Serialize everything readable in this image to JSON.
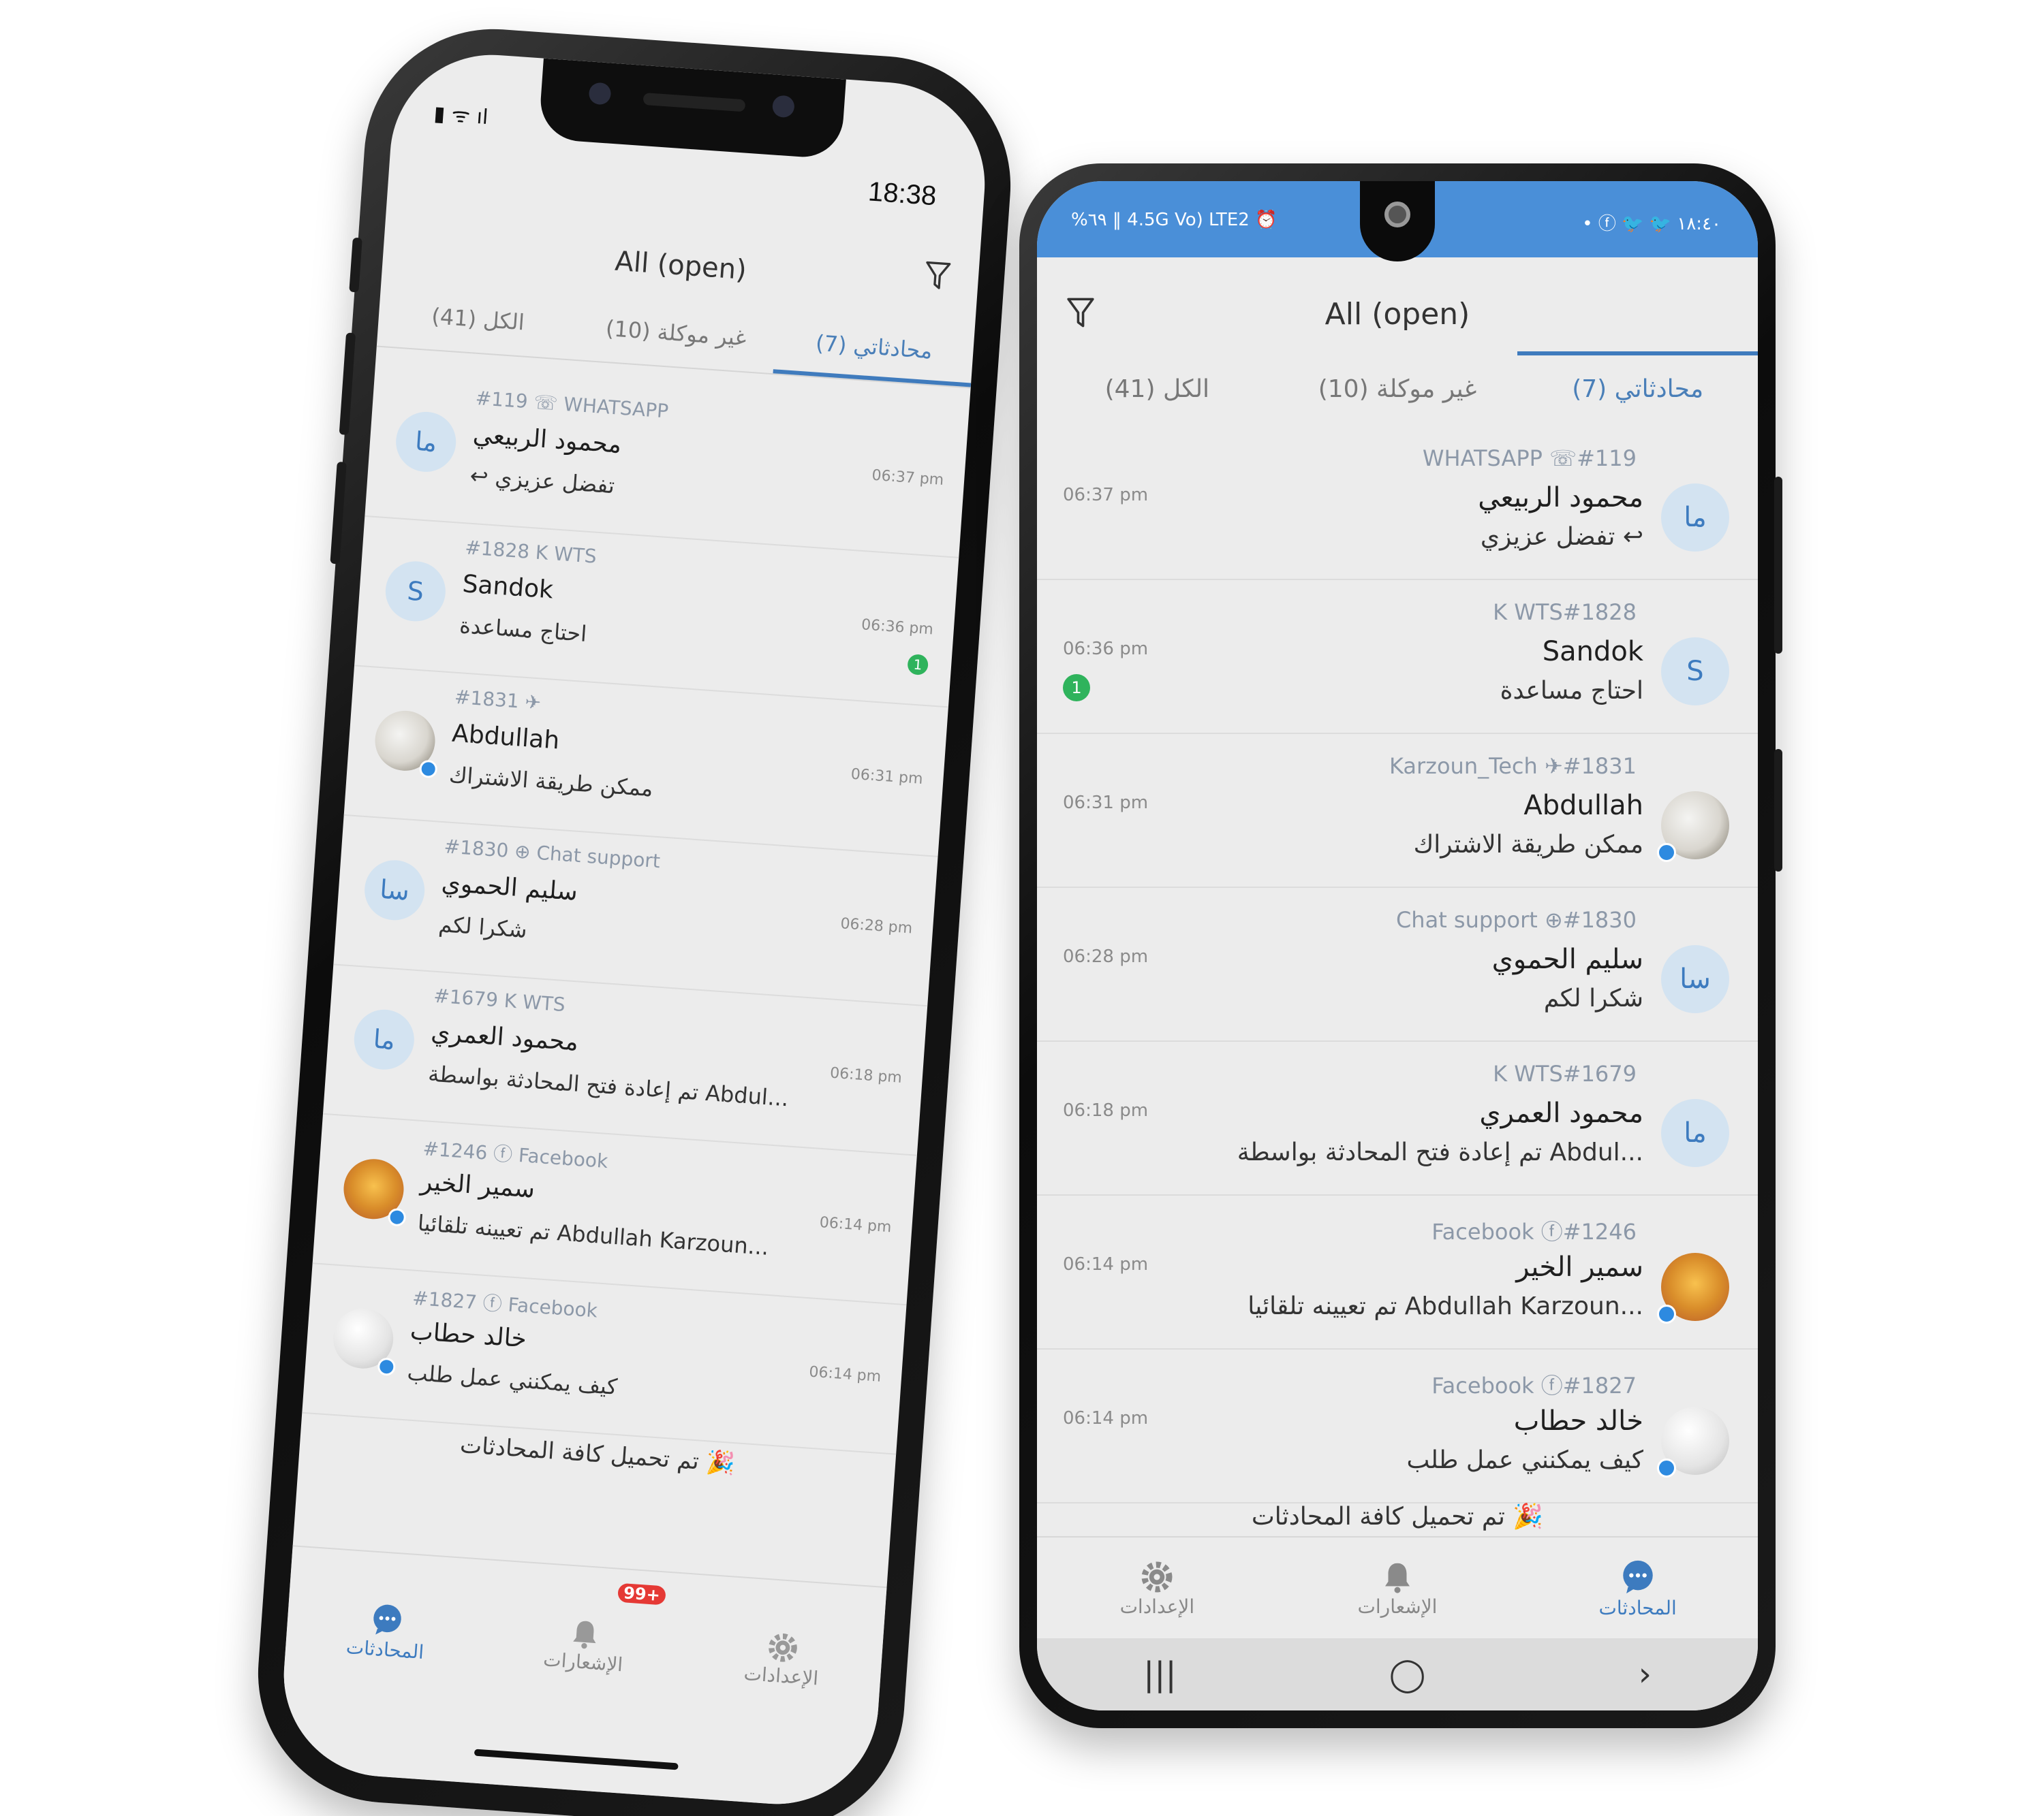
{
  "left_phone": {
    "status_time": "18:38",
    "title": "All (open)",
    "tabs": [
      {
        "label": "الكل (41)"
      },
      {
        "label": "غير موكلة (10)"
      },
      {
        "label": "محادثاتي (7)"
      }
    ],
    "conversations": [
      {
        "meta": "#119 ☏ WHATSAPP",
        "name": "محمود الربيعي",
        "message": "تفضل عزيزي",
        "time": "06:37 pm",
        "avatar": "ما"
      },
      {
        "meta": "#1828  K WTS",
        "name": "Sandok",
        "message": "احتاج مساعدة",
        "time": "06:36 pm",
        "avatar": "S",
        "badge": "1"
      },
      {
        "meta": "#1831 ✈",
        "name": "Abdullah",
        "message": "ممكن طريقة الاشتراك",
        "time": "06:31 pm",
        "avatar": ""
      },
      {
        "meta": "#1830 ⊕ Chat support",
        "name": "سليم الحموي",
        "message": "شكرا لكم",
        "time": "06:28 pm",
        "avatar": "سا"
      },
      {
        "meta": "#1679  K WTS",
        "name": "محمود العمري",
        "message": "تم إعادة فتح المحادثة بواسطة Abdul...",
        "time": "06:18 pm",
        "avatar": "ما"
      },
      {
        "meta": "#1246 ⓕ Facebook",
        "name": "سمير الخير",
        "message": "تم تعيينه تلقائيا Abdullah Karzoun...",
        "time": "06:14 pm",
        "avatar": ""
      },
      {
        "meta": "#1827 ⓕ Facebook",
        "name": "خالد حطاب",
        "message": "كيف يمكنني عمل طلب",
        "time": "06:14 pm",
        "avatar": ""
      }
    ],
    "all_loaded": "تم تحميل كافة المحادثات 🎉",
    "nav": [
      {
        "label": "المحادثات",
        "icon": "chat-icon"
      },
      {
        "label": "الإشعارات",
        "icon": "bell-icon",
        "badge": "99+"
      },
      {
        "label": "الإعدادات",
        "icon": "gear-icon"
      }
    ]
  },
  "right_phone": {
    "status_left": "%٦٩ ‖ 4.5G Vo) LTE2 ⏰",
    "status_right": "• ⓕ 🐦 🐦 ١٨:٤٠",
    "title": "All (open)",
    "tabs": [
      {
        "label": "الكل (41)"
      },
      {
        "label": "غير موكلة (10)"
      },
      {
        "label": "محادثاتي (7)"
      }
    ],
    "conversations": [
      {
        "meta": "WHATSAPP ☏#119",
        "name": "محمود الربيعي",
        "message": "تفضل عزيزي",
        "time": "06:37 pm",
        "avatar": "ما"
      },
      {
        "meta": "K WTS#1828",
        "name": "Sandok",
        "message": "احتاج مساعدة",
        "time": "06:36 pm",
        "avatar": "S",
        "badge": "1"
      },
      {
        "meta": "Karzoun_Tech ✈#1831",
        "name": "Abdullah",
        "message": "ممكن طريقة الاشتراك",
        "time": "06:31 pm",
        "avatar": ""
      },
      {
        "meta": "Chat support ⊕#1830",
        "name": "سليم الحموي",
        "message": "شكرا لكم",
        "time": "06:28 pm",
        "avatar": "سا"
      },
      {
        "meta": "K WTS#1679",
        "name": "محمود العمري",
        "message": "تم إعادة فتح المحادثة بواسطة Abdul...",
        "time": "06:18 pm",
        "avatar": "ما"
      },
      {
        "meta": "Facebook ⓕ#1246",
        "name": "سمير الخير",
        "message": "تم تعيينه تلقائيا Abdullah Karzoun...",
        "time": "06:14 pm",
        "avatar": ""
      },
      {
        "meta": "Facebook ⓕ#1827",
        "name": "خالد حطاب",
        "message": "كيف يمكنني عمل طلب",
        "time": "06:14 pm",
        "avatar": ""
      }
    ],
    "all_loaded": "تم تحميل كافة المحادثات 🎉",
    "nav": [
      {
        "label": "الإعدادات",
        "icon": "gear-icon"
      },
      {
        "label": "الإشعارات",
        "icon": "bell-icon"
      },
      {
        "label": "المحادثات",
        "icon": "chat-icon"
      }
    ],
    "system_nav": [
      "|||",
      "◯",
      "›"
    ]
  },
  "colors": {
    "accent": "#3f7bbd",
    "status_bar": "#4a8fd8",
    "badge_green": "#2fb35c",
    "badge_red": "#e53935"
  }
}
